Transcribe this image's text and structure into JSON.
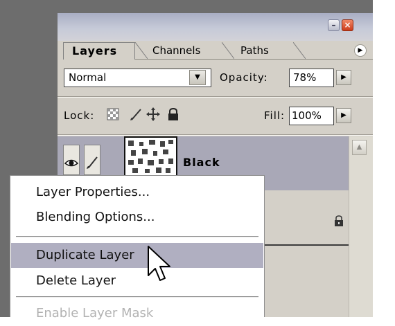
{
  "palette": {
    "tabs": [
      {
        "label": "Layers",
        "active": true
      },
      {
        "label": "Channels",
        "active": false
      },
      {
        "label": "Paths",
        "active": false
      }
    ],
    "blend_mode": "Normal",
    "opacity_label": "Opacity:",
    "opacity_value": "78%",
    "lock_label": "Lock:",
    "fill_label": "Fill:",
    "fill_value": "100%",
    "layers": [
      {
        "name": "Black",
        "selected": true,
        "visible": true
      }
    ]
  },
  "context_menu": {
    "items": [
      {
        "label": "Layer Properties...",
        "enabled": true
      },
      {
        "label": "Blending Options...",
        "enabled": true
      },
      {
        "label": "Duplicate Layer",
        "enabled": true,
        "highlighted": true
      },
      {
        "label": "Delete Layer",
        "enabled": true
      },
      {
        "label": "Enable Layer Mask",
        "enabled": false
      }
    ]
  },
  "colors": {
    "background": "#6d6d6d",
    "panel": "#d4d0c8",
    "selected_row": "#a9a8b7",
    "menu_highlight": "#b0afc1"
  },
  "icons": [
    "minimize-icon",
    "close-icon",
    "palette-menu-icon",
    "eye-icon",
    "brush-icon",
    "lock-transparent-icon",
    "lock-brush-icon",
    "lock-move-icon",
    "lock-all-icon",
    "padlock-icon",
    "scroll-up-icon",
    "cursor-icon"
  ]
}
